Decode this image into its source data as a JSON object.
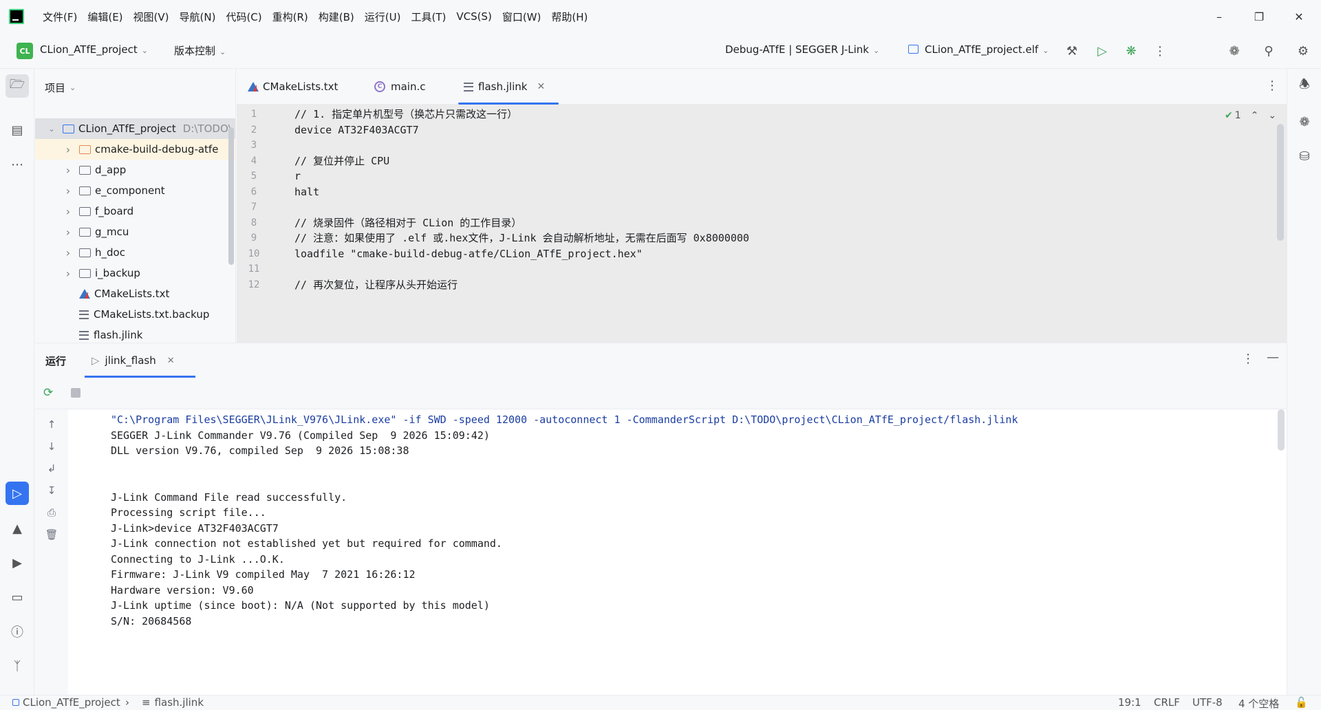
{
  "menubar": {
    "items": [
      "文件(F)",
      "编辑(E)",
      "视图(V)",
      "导航(N)",
      "代码(C)",
      "重构(R)",
      "构建(B)",
      "运行(U)",
      "工具(T)",
      "VCS(S)",
      "窗口(W)",
      "帮助(H)"
    ]
  },
  "toolbar": {
    "project_badge": "CL",
    "project_name": "CLion_ATfE_project",
    "vcs_label": "版本控制",
    "run_config": "Debug-ATfE | SEGGER J-Link",
    "target": "CLion_ATfE_project.elf"
  },
  "project_panel": {
    "title": "项目",
    "root_name": "CLion_ATfE_project",
    "root_path": "D:\\TODO\\",
    "items": [
      {
        "name": "cmake-build-debug-atfe",
        "type": "folder"
      },
      {
        "name": "d_app",
        "type": "folder"
      },
      {
        "name": "e_component",
        "type": "folder"
      },
      {
        "name": "f_board",
        "type": "folder"
      },
      {
        "name": "g_mcu",
        "type": "folder"
      },
      {
        "name": "h_doc",
        "type": "folder"
      },
      {
        "name": "i_backup",
        "type": "folder"
      },
      {
        "name": "CMakeLists.txt",
        "type": "cmake"
      },
      {
        "name": "CMakeLists.txt.backup",
        "type": "text"
      },
      {
        "name": "flash.jlink",
        "type": "text"
      }
    ]
  },
  "editor": {
    "tabs": [
      {
        "label": "CMakeLists.txt"
      },
      {
        "label": "main.c"
      },
      {
        "label": "flash.jlink"
      }
    ],
    "inspection_count": "1",
    "lines": [
      {
        "num": "1",
        "text": "// 1. 指定单片机型号（换芯片只需改这一行）"
      },
      {
        "num": "2",
        "text": "device AT32F403ACGT7"
      },
      {
        "num": "3",
        "text": ""
      },
      {
        "num": "4",
        "text": "// 复位并停止 CPU"
      },
      {
        "num": "5",
        "text": "r"
      },
      {
        "num": "6",
        "text": "halt"
      },
      {
        "num": "7",
        "text": ""
      },
      {
        "num": "8",
        "text": "// 烧录固件（路径相对于 CLion 的工作目录）"
      },
      {
        "num": "9",
        "text": "// 注意：如果使用了 .elf 或.hex文件，J-Link 会自动解析地址，无需在后面写 0x8000000"
      },
      {
        "num": "10",
        "text": "loadfile \"cmake-build-debug-atfe/CLion_ATfE_project.hex\""
      },
      {
        "num": "11",
        "text": ""
      },
      {
        "num": "12",
        "text": "// 再次复位，让程序从头开始运行"
      }
    ]
  },
  "run_panel": {
    "title": "运行",
    "tab_label": "jlink_flash",
    "console": [
      {
        "text": "\"C:\\Program Files\\SEGGER\\JLink_V976\\JLink.exe\" -if SWD -speed 12000 -autoconnect 1 -CommanderScript D:\\TODO\\project\\CLion_ATfE_project/flash.jlink",
        "kind": "cmd"
      },
      {
        "text": "SEGGER J-Link Commander V9.76 (Compiled Sep  9 2026 15:09:42)",
        "kind": "out"
      },
      {
        "text": "DLL version V9.76, compiled Sep  9 2026 15:08:38",
        "kind": "out"
      },
      {
        "text": "",
        "kind": "out"
      },
      {
        "text": "",
        "kind": "out"
      },
      {
        "text": "J-Link Command File read successfully.",
        "kind": "out"
      },
      {
        "text": "Processing script file...",
        "kind": "out"
      },
      {
        "text": "J-Link>device AT32F403ACGT7",
        "kind": "out"
      },
      {
        "text": "J-Link connection not established yet but required for command.",
        "kind": "out"
      },
      {
        "text": "Connecting to J-Link ...O.K.",
        "kind": "out"
      },
      {
        "text": "Firmware: J-Link V9 compiled May  7 2021 16:26:12",
        "kind": "out"
      },
      {
        "text": "Hardware version: V9.60",
        "kind": "out"
      },
      {
        "text": "J-Link uptime (since boot): N/A (Not supported by this model)",
        "kind": "out"
      },
      {
        "text": "S/N: 20684568",
        "kind": "out"
      }
    ]
  },
  "statusbar": {
    "breadcrumb_project": "CLion_ATfE_project",
    "breadcrumb_file": "flash.jlink",
    "position": "19:1",
    "line_ending": "CRLF",
    "encoding": "UTF-8",
    "indent": "4 个空格"
  }
}
